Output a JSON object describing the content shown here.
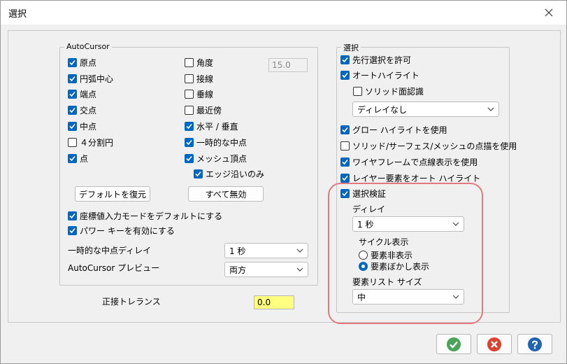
{
  "window": {
    "title": "選択"
  },
  "autocursor": {
    "legend": "AutoCursor",
    "checkboxes_left": [
      {
        "label": "原点",
        "checked": true
      },
      {
        "label": "円弧中心",
        "checked": true
      },
      {
        "label": "端点",
        "checked": true
      },
      {
        "label": "交点",
        "checked": true
      },
      {
        "label": "中点",
        "checked": true
      },
      {
        "label": "４分割円",
        "checked": false
      },
      {
        "label": "点",
        "checked": true
      }
    ],
    "checkboxes_right": [
      {
        "label": "角度",
        "checked": false
      },
      {
        "label": "接線",
        "checked": false
      },
      {
        "label": "垂線",
        "checked": false
      },
      {
        "label": "最近傍",
        "checked": false
      },
      {
        "label": "水平 / 垂直",
        "checked": true
      },
      {
        "label": "一時的な中点",
        "checked": true
      },
      {
        "label": "メッシュ頂点",
        "checked": true
      }
    ],
    "angle_value": "15.0",
    "edge_only": {
      "label": "エッジ沿いのみ",
      "checked": true
    },
    "restore_default_button": "デフォルトを復元",
    "disable_all_button": "すべて無効",
    "coord_input_default": {
      "label": "座標値入力モードをデフォルトにする",
      "checked": true
    },
    "power_key": {
      "label": "パワー キーを有効にする",
      "checked": true
    },
    "temp_midpoint_delay_label": "一時的な中点ディレイ",
    "temp_midpoint_delay_value": "1 秒",
    "preview_label": "AutoCursor プレビュー",
    "preview_value": "両方"
  },
  "tangent_tolerance": {
    "label": "正接トレランス",
    "value": "0.0"
  },
  "selection": {
    "legend": "選択",
    "allow_preselect": {
      "label": "先行選択を許可",
      "checked": true
    },
    "auto_highlight": {
      "label": "オートハイライト",
      "checked": true
    },
    "solid_face_recog": {
      "label": "ソリッド面認識",
      "checked": false
    },
    "delay_combo": "ディレイなし",
    "glow_highlight": {
      "label": "グロー ハイライトを使用",
      "checked": true
    },
    "solid_point_draw": {
      "label": "ソリッド/サーフェス/メッシュの点描を使用",
      "checked": false
    },
    "wireframe_dotted": {
      "label": "ワイヤフレームで点線表示を使用",
      "checked": true
    },
    "layer_auto_highlight": {
      "label": "レイヤー要素をオート ハイライト",
      "checked": true
    },
    "verify": {
      "label": "選択検証",
      "checked": true
    },
    "delay_label": "ディレイ",
    "delay_value": "1 秒",
    "cycle_label": "サイクル表示",
    "cycle_options": [
      {
        "label": "要素非表示",
        "selected": false
      },
      {
        "label": "要素ぼかし表示",
        "selected": true
      }
    ],
    "list_size_label": "要素リスト サイズ",
    "list_size_value": "中"
  },
  "colors": {
    "accent": "#0067c0",
    "highlight_ring": "#e07a7e",
    "tolerance_bg": "#ffff80",
    "ok": "#4aa55a",
    "cancel": "#d9432f",
    "help": "#1f63b5"
  },
  "footer": {
    "ok_icon": "check-icon",
    "cancel_icon": "x-icon",
    "help_icon": "question-icon"
  }
}
